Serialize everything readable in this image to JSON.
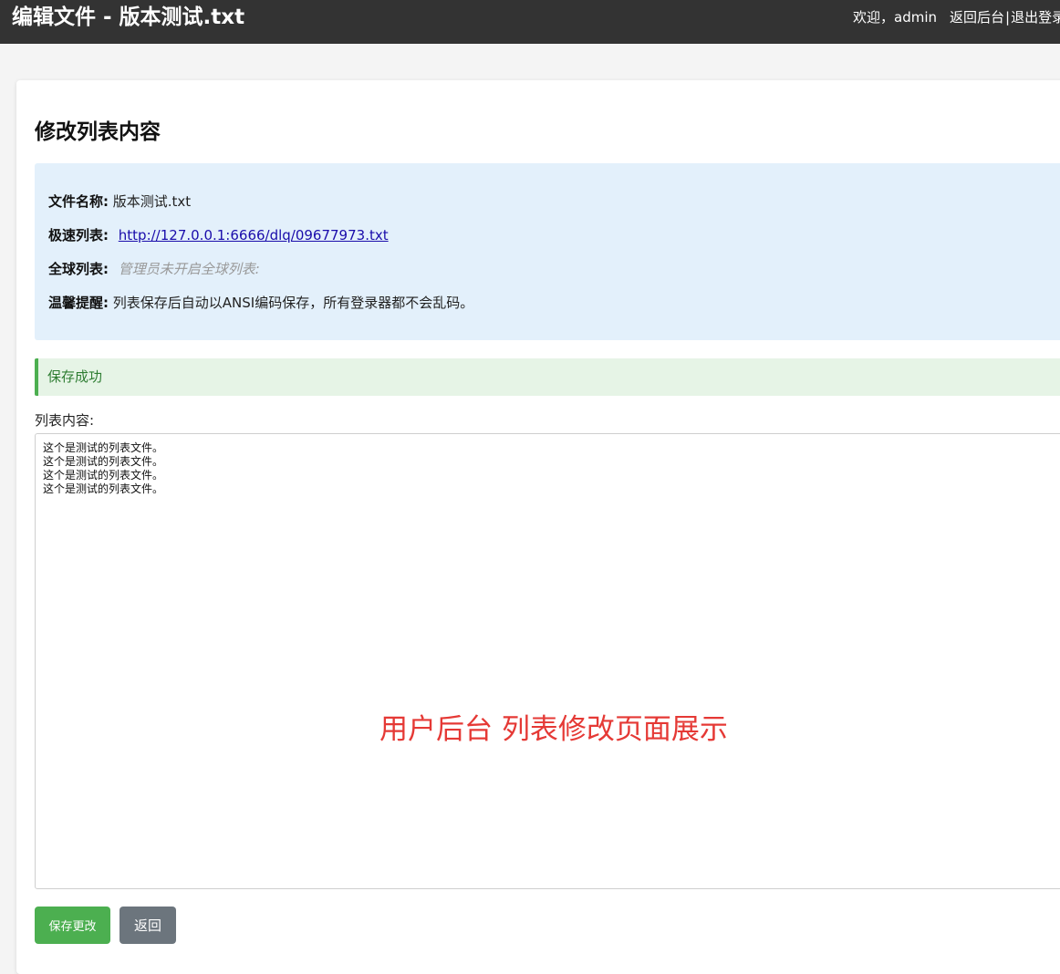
{
  "header": {
    "title": "编辑文件 - 版本测试.txt",
    "welcome": "欢迎，admin",
    "back_admin": "返回后台",
    "separator": "|",
    "logout": "退出登录"
  },
  "main": {
    "heading": "修改列表内容",
    "info": {
      "file_name_label": "文件名称:",
      "file_name": "版本测试.txt",
      "fast_list_label": "极速列表:",
      "fast_list_url": "http://127.0.0.1:6666/dlq/09677973.txt",
      "global_list_label": "全球列表:",
      "global_list_value": "管理员未开启全球列表:",
      "tip_label": "温馨提醒:",
      "tip_text": "列表保存后自动以ANSI编码保存，所有登录器都不会乱码。"
    },
    "alert": "保存成功",
    "content_label": "列表内容:",
    "content": "这个是测试的列表文件。\n这个是测试的列表文件。\n这个是测试的列表文件。\n这个是测试的列表文件。",
    "watermark": "用户后台 列表修改页面展示",
    "buttons": {
      "save": "保存更改",
      "back": "返回"
    }
  },
  "colors": {
    "header_bg": "#333333",
    "info_bg": "#e3f0fb",
    "alert_bg": "#e6f4e6",
    "alert_accent": "#4caf50",
    "save_button": "#4caf50",
    "back_button": "#6c757d",
    "watermark": "#e53935"
  }
}
